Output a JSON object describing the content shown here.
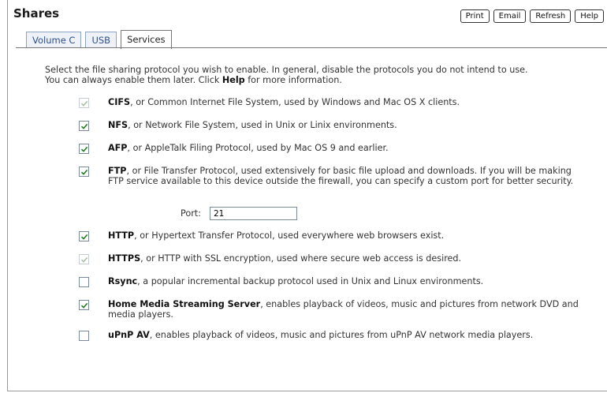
{
  "title": "Shares",
  "toolbar": {
    "print": "Print",
    "email": "Email",
    "refresh": "Refresh",
    "help": "Help"
  },
  "tabs": [
    {
      "label": "Volume C",
      "active": false
    },
    {
      "label": "USB",
      "active": false
    },
    {
      "label": "Services",
      "active": true
    }
  ],
  "intro": {
    "line1": "Select the file sharing protocol you wish to enable. In general, disable the protocols you do not intend to use.",
    "line2_pre": "You can always enable them later. Click ",
    "line2_bold": "Help",
    "line2_post": " for more information."
  },
  "options": [
    {
      "name": "CIFS",
      "desc": ", or Common Internet File System, used by Windows and Mac OS X clients.",
      "checked": true,
      "disabled": true
    },
    {
      "name": "NFS",
      "desc": ", or Network File System, used in Unix or Linix environments.",
      "checked": true,
      "disabled": false
    },
    {
      "name": "AFP",
      "desc": ", or AppleTalk Filing Protocol, used by Mac OS 9 and earlier.",
      "checked": true,
      "disabled": false
    },
    {
      "name": "FTP",
      "desc": ", or File Transfer Protocol, used extensively for basic file upload and downloads. If you will be making FTP service available to this device outside the firewall, you can specify a custom port for better security.",
      "checked": true,
      "disabled": false
    },
    {
      "name": "HTTP",
      "desc": ", or Hypertext Transfer Protocol, used everywhere web browsers exist.",
      "checked": true,
      "disabled": false
    },
    {
      "name": "HTTPS",
      "desc": ", or HTTP with SSL encryption, used where secure web access is desired.",
      "checked": true,
      "disabled": true
    },
    {
      "name": "Rsync",
      "desc": ", a popular incremental backup protocol used in Unix and Linux environments.",
      "checked": false,
      "disabled": false
    },
    {
      "name": "Home Media Streaming Server",
      "desc": ", enables playback of videos, music and pictures from network DVD and media players.",
      "checked": true,
      "disabled": false
    },
    {
      "name": "uPnP AV",
      "desc": ", enables playback of videos, music and pictures from uPnP AV network media players.",
      "checked": false,
      "disabled": false
    }
  ],
  "ftp_port": {
    "label": "Port:",
    "value": "21"
  },
  "colors": {
    "tab_text": "#2d4f8c",
    "check": "#1e7a1e",
    "check_disabled": "#a8bda8"
  },
  "icons": {
    "checkbox_mark": "check-icon"
  }
}
